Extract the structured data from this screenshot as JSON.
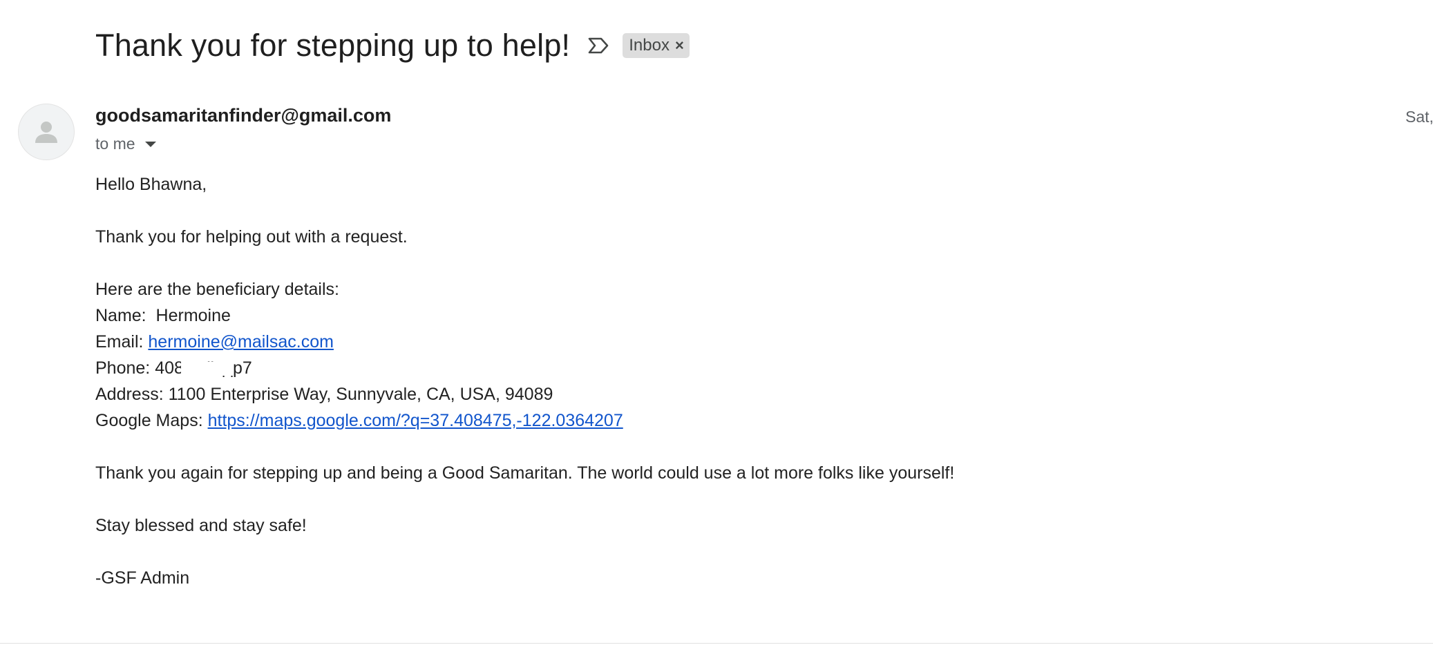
{
  "subject": "Thank you for stepping up to help!",
  "label": {
    "name": "Inbox",
    "remove_symbol": "×"
  },
  "message": {
    "sender": "goodsamaritanfinder@gmail.com",
    "date": "Sat,",
    "recipients": "to me",
    "body": {
      "greeting": "Hello Bhawna,",
      "line1": "Thank you for helping out with a request.",
      "details_intro": "Here are the beneficiary details:",
      "name_label": "Name:  ",
      "name_value": "Hermoine",
      "email_label": "Email: ",
      "email_value": "hermoine@mailsac.com",
      "phone_label": "Phone: ",
      "phone_value": "408-сс’’сдр7",
      "address_label": "Address: ",
      "address_value": "1100 Enterprise Way, Sunnyvale, CA, USA, 94089",
      "maps_label": "Google Maps: ",
      "maps_link": "https://maps.google.com/?q=37.408475,-122.0364207",
      "thanks": "Thank you again for stepping up and being a Good Samaritan. The world could use a lot more folks like yourself!",
      "closing": "Stay blessed and stay safe!",
      "signature": "-GSF Admin"
    }
  },
  "icons": {
    "importance": "importance-marker-icon",
    "avatar": "person-icon",
    "expand": "caret-down-icon"
  },
  "colors": {
    "link": "#1155cc",
    "chip_bg": "#dddddd",
    "text": "#222222",
    "muted": "#5f6368"
  }
}
